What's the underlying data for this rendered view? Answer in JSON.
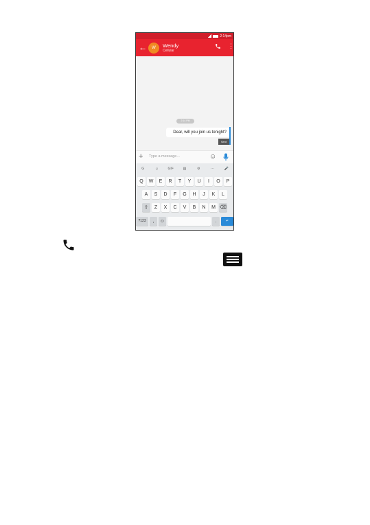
{
  "status": {
    "time": "2:14pm"
  },
  "appbar": {
    "back_glyph": "←",
    "avatar_initial": "W",
    "contact_name": "Wendy",
    "contact_sub": "Cellular",
    "call_icon": "phone-icon",
    "menu_icon": "overflow-menu-icon"
  },
  "thread": {
    "timestamp": "2:14 PM",
    "message": "Dear, will you join us tonight?",
    "status_label": "Sent"
  },
  "compose": {
    "plus_glyph": "+",
    "placeholder": "Type a message...",
    "emoji_glyph": "☺"
  },
  "keyboard": {
    "suggestions": [
      "G",
      "☺",
      "GIF",
      "▤",
      "⚙",
      "···",
      "🎤"
    ],
    "row1": [
      "Q",
      "W",
      "E",
      "R",
      "T",
      "Y",
      "U",
      "I",
      "O",
      "P"
    ],
    "row2": [
      "A",
      "S",
      "D",
      "F",
      "G",
      "H",
      "J",
      "K",
      "L"
    ],
    "row3": [
      "⇧",
      "Z",
      "X",
      "C",
      "V",
      "B",
      "N",
      "M",
      "⌫"
    ],
    "row4": [
      "?123",
      ",",
      "☺",
      "",
      ".",
      "↵"
    ]
  },
  "colors": {
    "appbar": "#e8232f",
    "statusbar": "#d01e2a",
    "avatar": "#f08a22",
    "accent": "#2a8ad8"
  },
  "icons": {
    "big_call": "phone-icon",
    "big_menu": "menu-icon"
  }
}
